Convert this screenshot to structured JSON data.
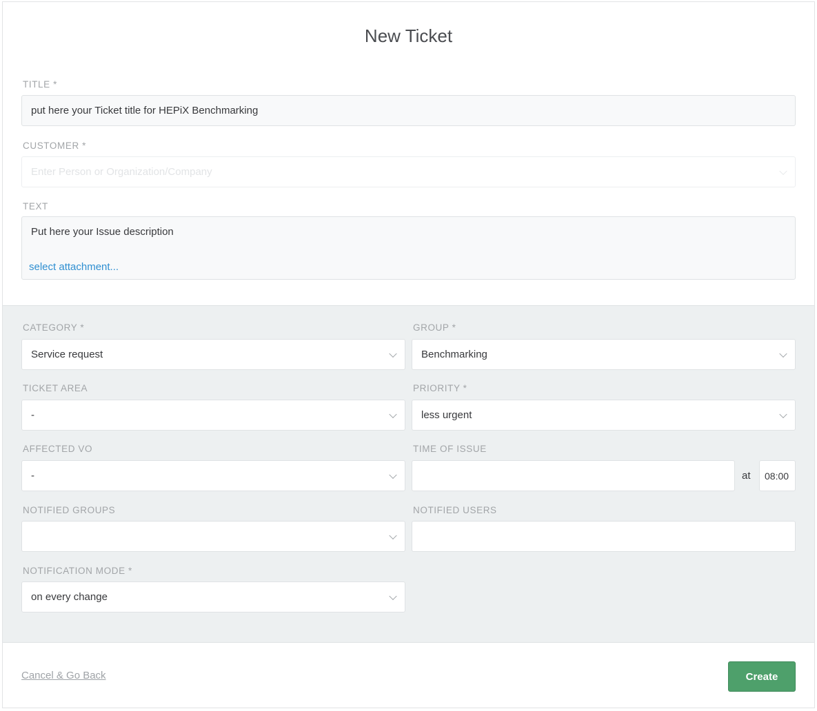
{
  "page": {
    "title": "New Ticket"
  },
  "fields": {
    "title": {
      "label": "TITLE *",
      "value": "put here your Ticket title for HEPiX Benchmarking"
    },
    "customer": {
      "label": "CUSTOMER *",
      "placeholder": "Enter Person or Organization/Company"
    },
    "text": {
      "label": "TEXT",
      "value": "Put here your Issue description",
      "attachment_link": "select attachment..."
    },
    "category": {
      "label": "CATEGORY *",
      "value": "Service request"
    },
    "group": {
      "label": "GROUP *",
      "value": "Benchmarking"
    },
    "ticket_area": {
      "label": "TICKET AREA",
      "value": "-"
    },
    "priority": {
      "label": "PRIORITY *",
      "value": "less urgent"
    },
    "affected_vo": {
      "label": "AFFECTED VO",
      "value": "-"
    },
    "time_of_issue": {
      "label": "TIME OF ISSUE",
      "date_value": "",
      "at_label": "at",
      "time_value": "08:00"
    },
    "notified_groups": {
      "label": "NOTIFIED GROUPS",
      "value": ""
    },
    "notified_users": {
      "label": "NOTIFIED USERS",
      "value": ""
    },
    "notification_mode": {
      "label": "NOTIFICATION MODE *",
      "value": "on every change"
    }
  },
  "actions": {
    "cancel_label": "Cancel & Go Back",
    "create_label": "Create"
  },
  "colors": {
    "accent_green": "#4ea06b",
    "link_blue": "#2f8fd1",
    "section_gray": "#edf0f1"
  }
}
